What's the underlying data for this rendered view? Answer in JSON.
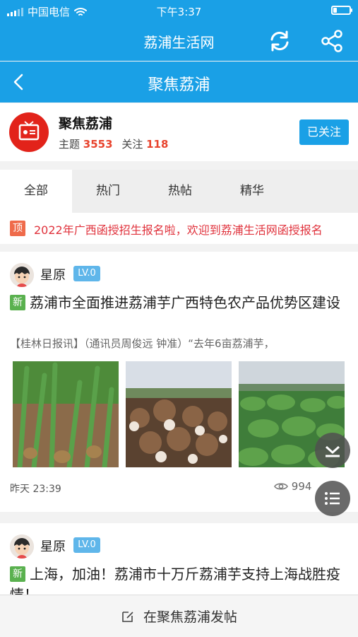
{
  "status_bar": {
    "carrier": "中国电信",
    "time": "下午3:37"
  },
  "app_bar": {
    "title": "荔浦生活网",
    "icons": [
      "refresh-icon",
      "share-icon"
    ]
  },
  "sub_bar": {
    "title": "聚焦荔浦",
    "back_icon": "chevron-left-icon"
  },
  "forum": {
    "name": "聚焦荔浦",
    "topics_label": "主题",
    "topics_count": "3553",
    "follow_label": "关注",
    "follow_count": "118",
    "follow_button": "已关注"
  },
  "tabs": [
    {
      "label": "全部",
      "active": true
    },
    {
      "label": "热门",
      "active": false
    },
    {
      "label": "热帖",
      "active": false
    },
    {
      "label": "精华",
      "active": false
    }
  ],
  "pinned": {
    "badge": "顶",
    "text": "2022年广西函授招生报名啦，欢迎到荔浦生活网函授报名"
  },
  "posts": [
    {
      "author": "星原",
      "level": "LV.0",
      "new_badge": "新",
      "title": "荔浦市全面推进荔浦芋广西特色农产品优势区建设",
      "summary": "【桂林日报讯】（通讯员周俊远 钟准）“去年6亩荔浦芋，",
      "time": "昨天 23:39",
      "views": "994"
    },
    {
      "author": "星原",
      "level": "LV.0",
      "new_badge": "新",
      "title": "上海，加油！荔浦市十万斤荔浦芋支持上海战胜疫情！"
    }
  ],
  "bottom_bar": {
    "label": "在聚焦荔浦发帖"
  },
  "colors": {
    "primary": "#1aa0e6",
    "accent": "#e8442e",
    "new_badge": "#5ab14f"
  }
}
